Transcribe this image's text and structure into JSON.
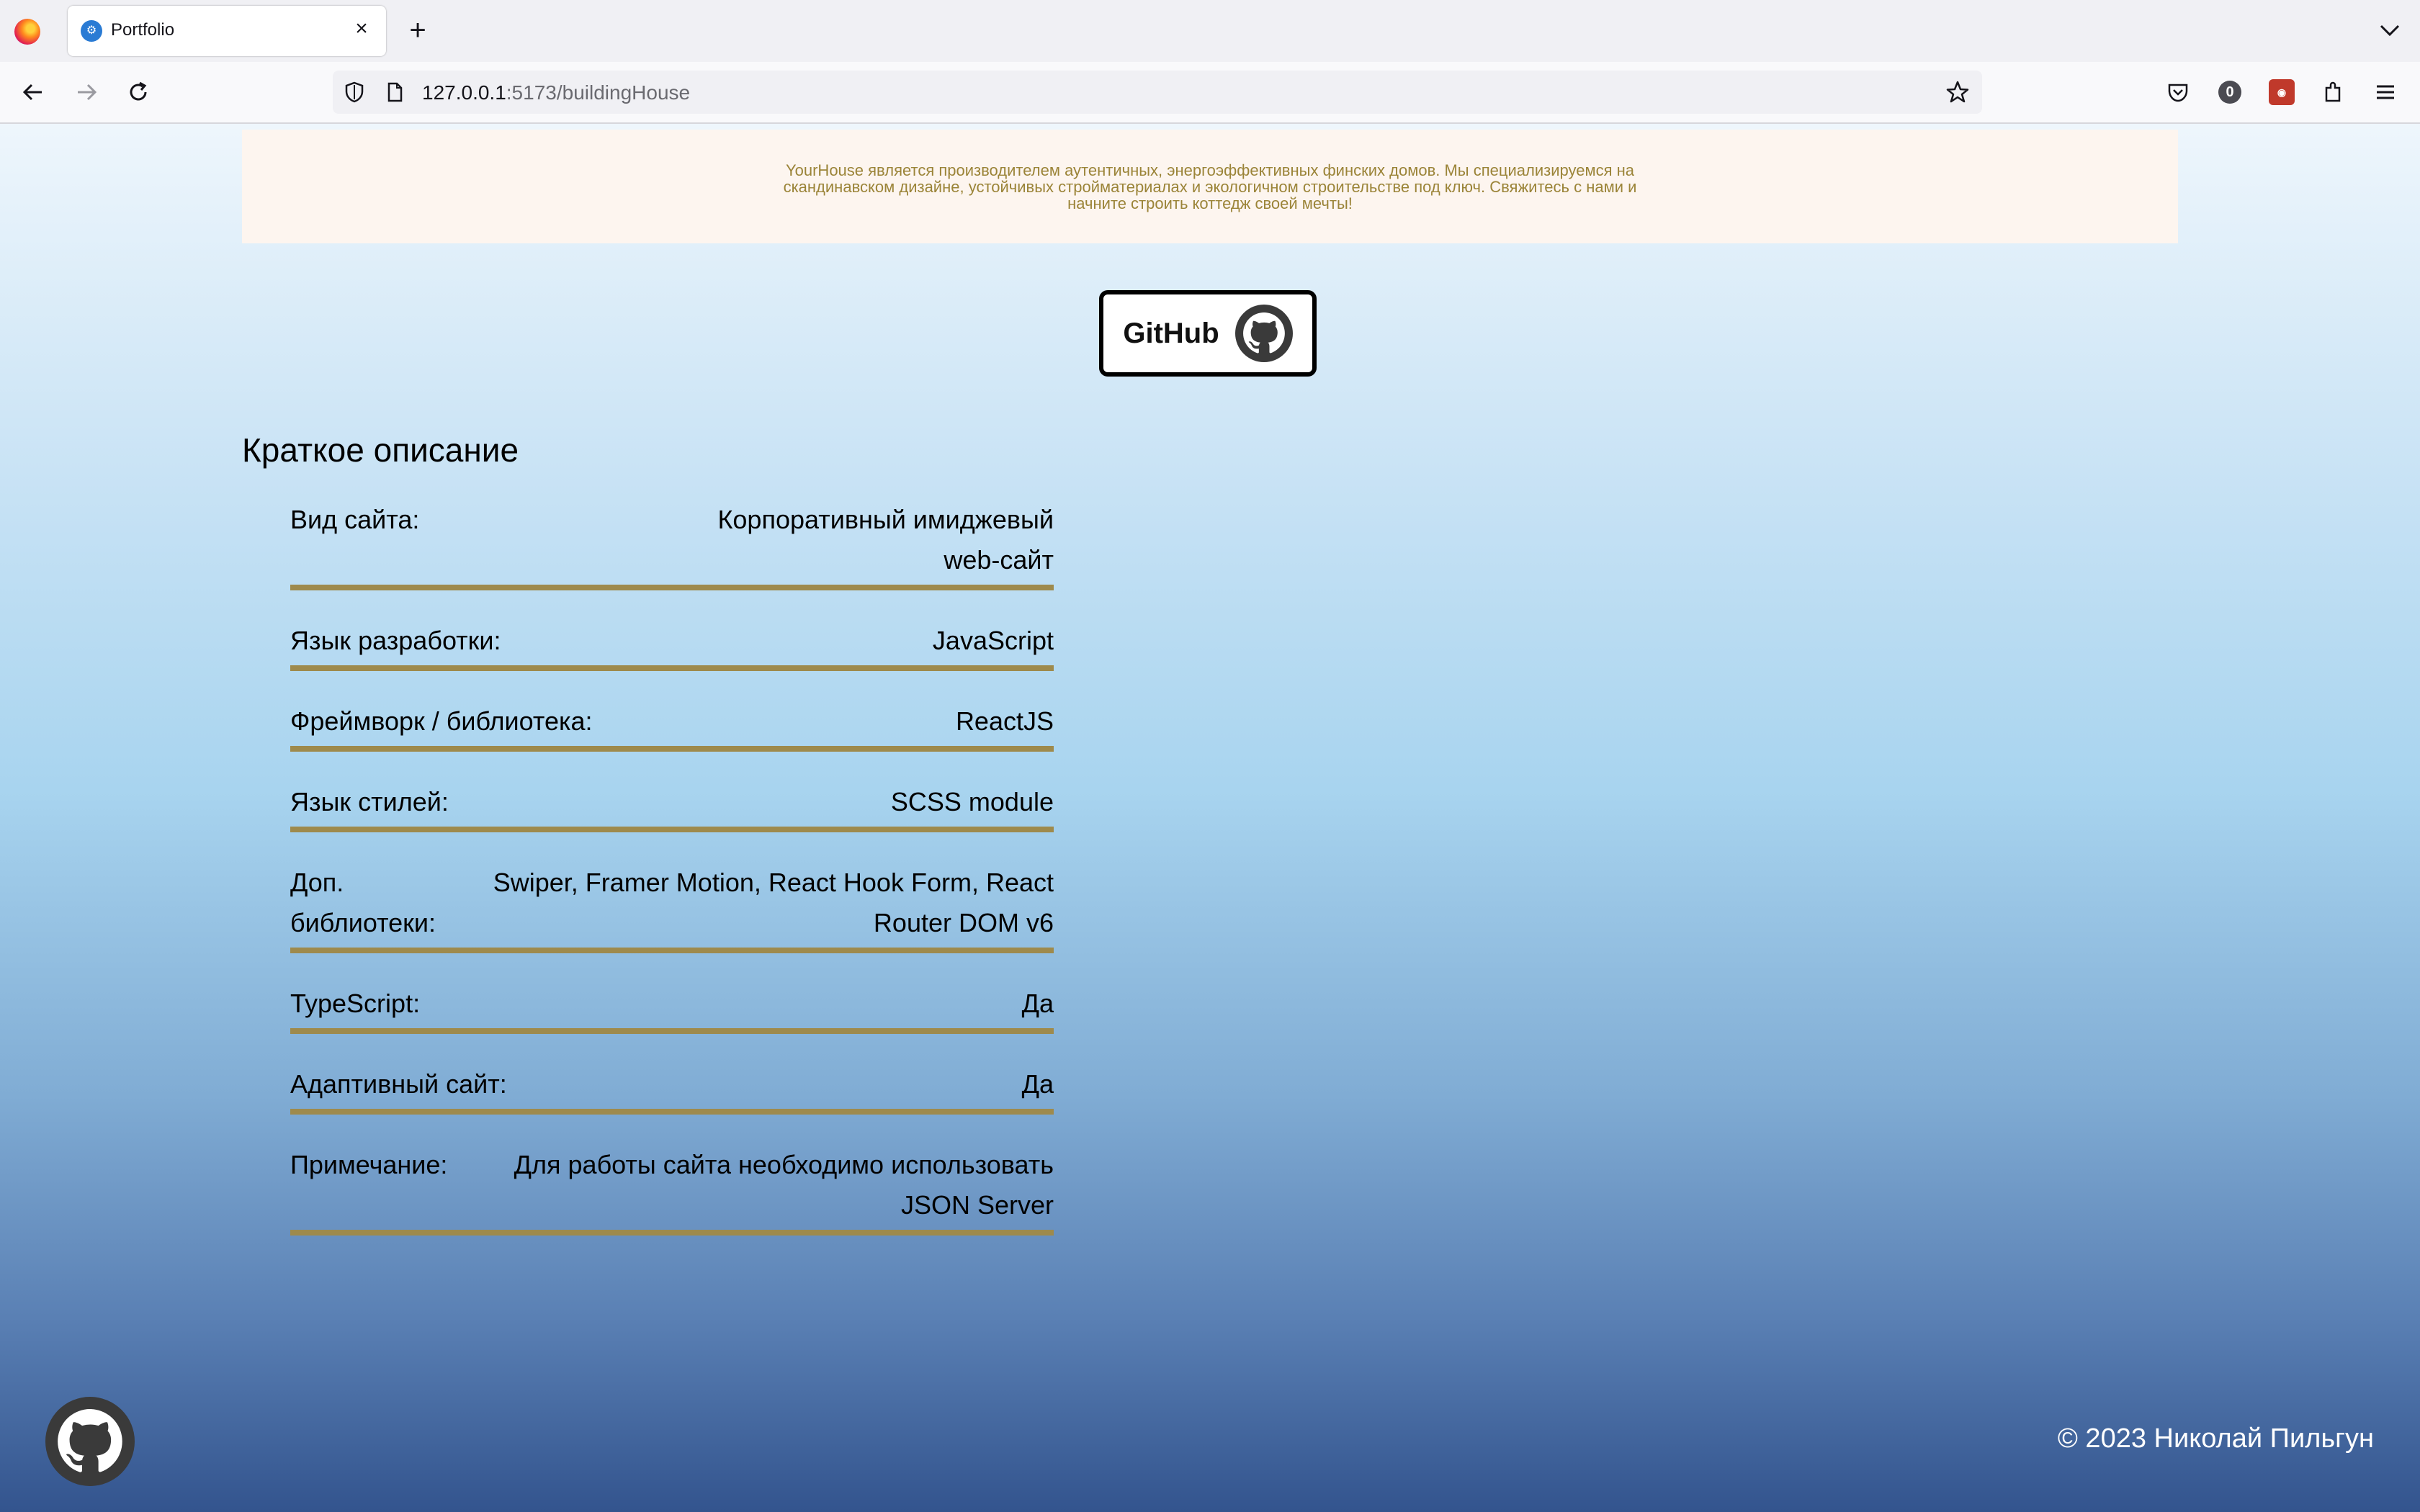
{
  "browser": {
    "tab_title": "Portfolio",
    "url_host": "127.0.0.1",
    "url_rest": ":5173/buildingHouse",
    "badge_count": "0"
  },
  "banner": {
    "text": "YourHouse является производителем аутентичных, энергоэффективных финских домов. Мы специализируемся на скандинавском дизайне, устойчивых стройматериалах и экологичном строительстве под ключ. Свяжитесь с нами и начните строить коттедж своей мечты!"
  },
  "github_button": {
    "label": "GitHub"
  },
  "section_title": "Краткое описание",
  "specs": [
    {
      "label": "Вид сайта:",
      "value": "Корпоративный имиджевый web-сайт"
    },
    {
      "label": "Язык разработки:",
      "value": "JavaScript"
    },
    {
      "label": "Фреймворк / библиотека:",
      "value": "ReactJS"
    },
    {
      "label": "Язык стилей:",
      "value": "SCSS module"
    },
    {
      "label": "Доп. библиотеки:",
      "value": "Swiper, Framer Motion, React Hook Form, React Router DOM v6"
    },
    {
      "label": "TypeScript:",
      "value": "Да"
    },
    {
      "label": "Адаптивный сайт:",
      "value": "Да"
    },
    {
      "label": "Примечание:",
      "value": "Для работы сайта необходимо использовать JSON Server"
    }
  ],
  "footer": {
    "copyright": "© 2023 Николай Пильгун"
  },
  "colors": {
    "accent_underline": "#9e8a4c",
    "banner_text": "#9b8438",
    "banner_bg": "#fdf5ef"
  }
}
